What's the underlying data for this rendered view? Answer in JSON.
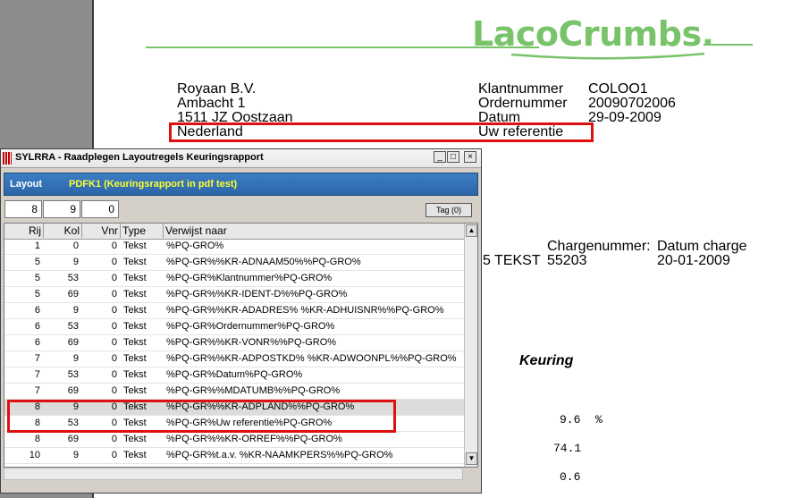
{
  "logo": {
    "text": "LacoCrumbs.",
    "color": "#79c36a"
  },
  "address": {
    "name": "Royaan B.V.",
    "street": "Ambacht 1",
    "city": "1511 JZ  Oostzaan",
    "country": "Nederland"
  },
  "fields": [
    {
      "label": "Klantnummer",
      "value": "COLOO1"
    },
    {
      "label": "Ordernummer",
      "value": "20090702006"
    },
    {
      "label": "Datum",
      "value": "29-09-2009"
    },
    {
      "label": "Uw referentie",
      "value": ""
    }
  ],
  "charge": {
    "header_nr": "Chargenummer:",
    "header_date": "Datum charge",
    "prefix": "5 TEKST",
    "number": "55203",
    "date": "20-01-2009"
  },
  "keuring": {
    "title": "Keuring",
    "values": [
      "9.6",
      "74.1",
      "0.6"
    ],
    "unit": "%"
  },
  "dialog": {
    "title": "SYLRRA - Raadplegen Layoutregels Keuringsrapport",
    "layout_label": "Layout",
    "layout_value": "PDFK1  (Keuringsrapport in pdf test)",
    "inputs": [
      "8",
      "9",
      "0"
    ],
    "tag_button": "Tag (0)",
    "columns": [
      "Rij",
      "Kol",
      "Vnr",
      "Type",
      "Verwijst naar"
    ],
    "rows": [
      {
        "rij": "1",
        "kol": "0",
        "vnr": "0",
        "type": "Tekst",
        "ref": "%PQ-GRO%"
      },
      {
        "rij": "5",
        "kol": "9",
        "vnr": "0",
        "type": "Tekst",
        "ref": "%PQ-GR%%KR-ADNAAM50%%PQ-GRO%"
      },
      {
        "rij": "5",
        "kol": "53",
        "vnr": "0",
        "type": "Tekst",
        "ref": "%PQ-GR%Klantnummer%PQ-GRO%"
      },
      {
        "rij": "5",
        "kol": "69",
        "vnr": "0",
        "type": "Tekst",
        "ref": "%PQ-GR%%KR-IDENT-D%%PQ-GRO%"
      },
      {
        "rij": "6",
        "kol": "9",
        "vnr": "0",
        "type": "Tekst",
        "ref": "%PQ-GR%%KR-ADADRES% %KR-ADHUISNR%%PQ-GRO%"
      },
      {
        "rij": "6",
        "kol": "53",
        "vnr": "0",
        "type": "Tekst",
        "ref": "%PQ-GR%Ordernummer%PQ-GRO%"
      },
      {
        "rij": "6",
        "kol": "69",
        "vnr": "0",
        "type": "Tekst",
        "ref": "%PQ-GR%%KR-VONR%%PQ-GRO%"
      },
      {
        "rij": "7",
        "kol": "9",
        "vnr": "0",
        "type": "Tekst",
        "ref": "%PQ-GR%%KR-ADPOSTKD%  %KR-ADWOONPL%%PQ-GRO%"
      },
      {
        "rij": "7",
        "kol": "53",
        "vnr": "0",
        "type": "Tekst",
        "ref": "%PQ-GR%Datum%PQ-GRO%"
      },
      {
        "rij": "7",
        "kol": "69",
        "vnr": "0",
        "type": "Tekst",
        "ref": "%PQ-GR%%MDATUMB%%PQ-GRO%"
      },
      {
        "rij": "8",
        "kol": "9",
        "vnr": "0",
        "type": "Tekst",
        "ref": "%PQ-GR%%KR-ADPLAND%%PQ-GRO%"
      },
      {
        "rij": "8",
        "kol": "53",
        "vnr": "0",
        "type": "Tekst",
        "ref": "%PQ-GR%Uw referentie%PQ-GRO%"
      },
      {
        "rij": "8",
        "kol": "69",
        "vnr": "0",
        "type": "Tekst",
        "ref": "%PQ-GR%%KR-ORREF%%PQ-GRO%"
      },
      {
        "rij": "10",
        "kol": "9",
        "vnr": "0",
        "type": "Tekst",
        "ref": "%PQ-GR%t.a.v. %KR-NAAMKPERS%%PQ-GRO%"
      }
    ]
  }
}
